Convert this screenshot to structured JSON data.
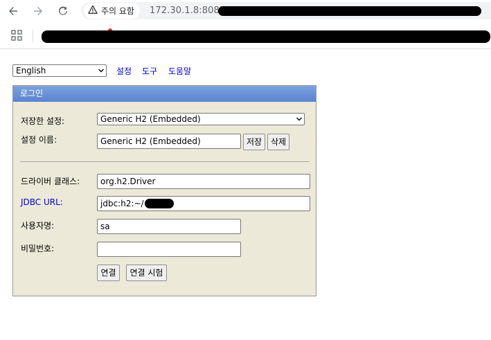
{
  "browser": {
    "security_label": "주의 요함",
    "url": "172.30.1.8:8082/",
    "icons": [
      "back-arrow-icon",
      "forward-arrow-icon",
      "reload-icon",
      "warning-icon",
      "apps-grid-icon"
    ]
  },
  "top_bar": {
    "language": "English",
    "links": [
      "설정",
      "도구",
      "도움말"
    ]
  },
  "login": {
    "header": "로그인",
    "saved_settings_label": "저장한 설정:",
    "saved_settings_value": "Generic H2 (Embedded)",
    "setting_name_label": "설정 이름:",
    "setting_name_value": "Generic H2 (Embedded)",
    "save_button": "저장",
    "delete_button": "삭제",
    "driver_label": "드라이버 클래스:",
    "driver_value": "org.h2.Driver",
    "jdbc_label": "JDBC URL:",
    "jdbc_value": "jdbc:h2:~/",
    "username_label": "사용자명:",
    "username_value": "sa",
    "password_label": "비밀번호:",
    "password_value": "",
    "connect_button": "연결",
    "test_button": "연결 시험"
  },
  "colors": {
    "panel_bg": "#ece9d8",
    "header_bg": "#6a92d8",
    "link": "#0000cc"
  }
}
